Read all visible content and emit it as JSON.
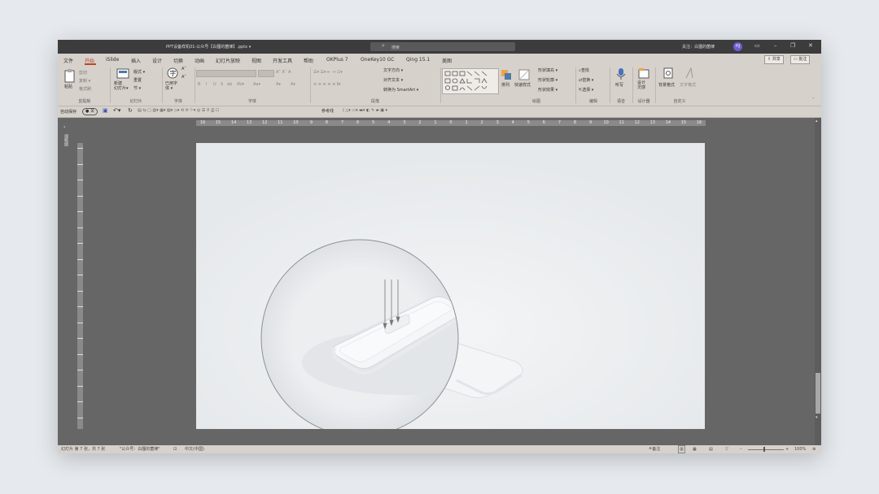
{
  "window": {
    "doc_title": "PPT设备样机01-公众号【白狸的菌律】.pptx  ▾",
    "search_placeholder": "搜索",
    "follow_text": "关注：白狸的菌律",
    "avatar_text": "HJ",
    "window_controls": [
      "▭",
      "–",
      "❐",
      "✕"
    ]
  },
  "menu": {
    "items": [
      "文件",
      "开始",
      "iSlide",
      "插入",
      "设计",
      "切换",
      "动画",
      "幻灯片放映",
      "视图",
      "开发工具",
      "帮助",
      "OKPlus 7",
      "OneKey10 GC",
      "Qing 15.1",
      "美图"
    ],
    "active_index": 1,
    "share_label": "共享",
    "comment_label": "批注"
  },
  "ribbon": {
    "clipboard": {
      "paste": "粘贴",
      "cut": "剪切",
      "copy": "复制 ▾",
      "format_painter": "格式刷",
      "group": "剪贴板"
    },
    "slides": {
      "new_slide": "新建\n幻灯片▾",
      "layout": "版式 ▾",
      "reset": "重置",
      "section": "节 ▾",
      "group": "幻灯片"
    },
    "font_style": {
      "label": "已用字\n体 ▾",
      "group": "字体"
    },
    "font": {
      "group": "字体",
      "buttons": [
        "B",
        "I",
        "U",
        "S",
        "ab",
        "AV▾",
        "Aa▾",
        "A▾",
        "A▾"
      ]
    },
    "paragraph": {
      "text_direction": "文字方向 ▾",
      "align_text": "对齐文本 ▾",
      "smartart": "转换为 SmartArt ▾",
      "group": "段落"
    },
    "drawing": {
      "arrange": "排列",
      "quick_styles": "快速样式",
      "fill": "形状填充 ▾",
      "outline": "形状轮廓 ▾",
      "effects": "形状效果 ▾",
      "group": "绘图"
    },
    "editing": {
      "find": "查找",
      "replace": "替换 ▾",
      "select": "选择 ▾",
      "group": "编辑"
    },
    "voice": {
      "dictate": "听写",
      "group": "语音"
    },
    "designer": {
      "label": "设计\n灵感",
      "group": "设计器"
    },
    "custom": {
      "bg_format": "背景格式",
      "text_format": "文字格式",
      "group": "自定义"
    }
  },
  "qat": {
    "autosave": "自动保存",
    "toggle": "关",
    "reference": "参考线"
  },
  "ruler": {
    "ticks": [
      "16",
      "15",
      "14",
      "13",
      "12",
      "11",
      "10",
      "9",
      "8",
      "7",
      "6",
      "5",
      "4",
      "3",
      "2",
      "1",
      "0",
      "1",
      "2",
      "3",
      "4",
      "5",
      "6",
      "7",
      "8",
      "9",
      "10",
      "11",
      "12",
      "13",
      "14",
      "15",
      "16"
    ]
  },
  "statusbar": {
    "slide_info": "幻灯片 第 7 张，共 7 张",
    "theme": "\"公众号：白狸的菌律\"",
    "lang": "中文(中国)",
    "notes": "备注",
    "zoom": "100%"
  },
  "colors": {
    "accent": "#b7472a",
    "titlebar": "#3c3c3c",
    "ribbon": "#d7d1cc",
    "workspace": "#666666",
    "slide_bg": "#e9ecee",
    "avatar": "#6b5fd3"
  },
  "sidepane": {
    "label": "缩略图"
  }
}
